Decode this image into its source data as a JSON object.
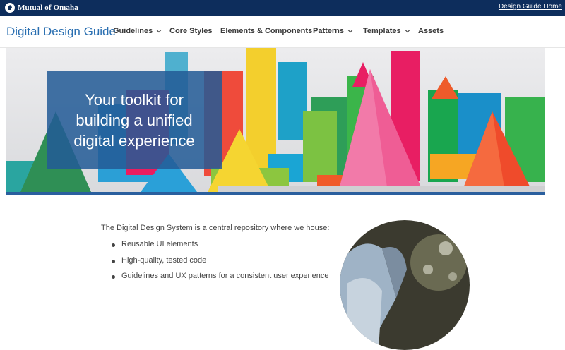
{
  "topbar": {
    "logo_text": "Mutual of Omaha",
    "logo_icon": "indian-head-logo-icon",
    "link_label": "Design Guide Home"
  },
  "nav": {
    "brand": "Digital Design Guide",
    "items": [
      {
        "label": "Guidelines",
        "has_dropdown": true
      },
      {
        "label": "Core Styles",
        "has_dropdown": false
      },
      {
        "label": "Elements & Components",
        "has_dropdown": false
      },
      {
        "label": "Patterns",
        "has_dropdown": true
      },
      {
        "label": "Templates",
        "has_dropdown": true
      },
      {
        "label": "Assets",
        "has_dropdown": false
      }
    ],
    "dropdown_icon": "chevron-down-icon"
  },
  "hero": {
    "headline": "Your toolkit for building a unified digital experience"
  },
  "content": {
    "intro": "The Digital Design System is a central repository where we house:",
    "bullets": [
      "Reusable UI elements",
      "High-quality, tested code",
      "Guidelines and UX patterns for a consistent user experience"
    ]
  },
  "colors": {
    "topbar": "#0d2d5c",
    "brand": "#2a6fb1",
    "hero_panel": "#235b96",
    "hero_bar": "#2a5f9e"
  }
}
